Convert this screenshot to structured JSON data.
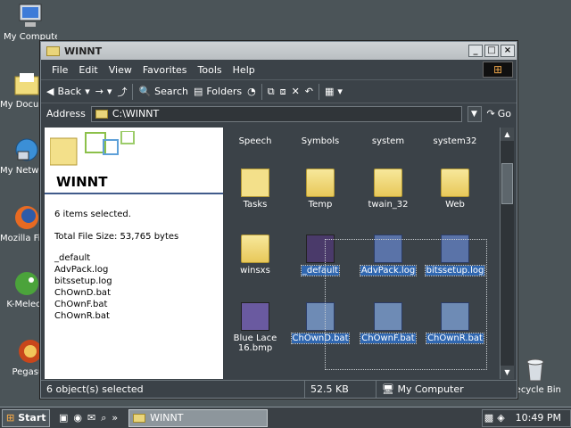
{
  "desktop": {
    "icons": [
      {
        "label": "My Computer"
      },
      {
        "label": "My Documents"
      },
      {
        "label": "My Network Places"
      },
      {
        "label": "Mozilla Firefox"
      },
      {
        "label": "K-Meleon"
      },
      {
        "label": "Pegasus"
      }
    ],
    "recycle_bin": "Recycle Bin"
  },
  "window": {
    "title": "WINNT",
    "menu": [
      "File",
      "Edit",
      "View",
      "Favorites",
      "Tools",
      "Help"
    ],
    "toolbar": {
      "back": "Back",
      "search": "Search",
      "folders": "Folders"
    },
    "address": {
      "label": "Address",
      "value": "C:\\WINNT",
      "go": "Go"
    }
  },
  "left_pane": {
    "folder_name": "WINNT",
    "selected_count": "6 items selected.",
    "total_size": "Total File Size: 53,765 bytes",
    "files": [
      "_default",
      "AdvPack.log",
      "bitssetup.log",
      "ChOwnD.bat",
      "ChOwnF.bat",
      "ChOwnR.bat"
    ]
  },
  "items": {
    "row0": [
      "Speech",
      "Symbols",
      "system",
      "system32"
    ],
    "row1": [
      "Tasks",
      "Temp",
      "twain_32",
      "Web"
    ],
    "row2": [
      "winsxs",
      "_default",
      "AdvPack.log",
      "bitssetup.log"
    ],
    "row3": [
      "Blue Lace 16.bmp",
      "ChOwnD.bat",
      "ChOwnF.bat",
      "ChOwnR.bat"
    ]
  },
  "status": {
    "objects": "6 object(s) selected",
    "size": "52.5 KB",
    "zone": "My Computer"
  },
  "taskbar": {
    "start": "Start",
    "task": "WINNT",
    "clock": "10:49 PM"
  }
}
